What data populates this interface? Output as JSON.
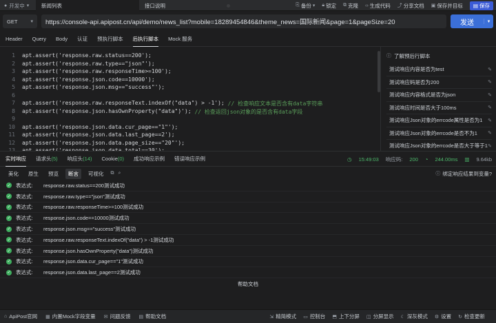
{
  "titlebar": {
    "env": "开发中",
    "tabs": [
      {
        "label": "新闻列表"
      },
      {
        "label": "接口说明"
      }
    ],
    "actions": [
      "备份",
      "锁定",
      "克隆",
      "生成代码",
      "分享文档",
      "保存并目标"
    ],
    "save_label": "保存"
  },
  "request": {
    "method": "GET",
    "url": "https://console-api.apipost.cn/api/demo/news_list?mobile=18289454846&theme_news=国际新闻&page=1&pageSize=20",
    "send_label": "发送"
  },
  "request_tabs": [
    "Header",
    "Query",
    "Body",
    "认证",
    "预执行脚本",
    "后执行脚本",
    "Mock 服务"
  ],
  "editor": {
    "lines": [
      {
        "n": "1",
        "code": "apt.assert('response.raw.status==200');",
        "comment": ""
      },
      {
        "n": "2",
        "code": "apt.assert('response.raw.type==\"json\"');",
        "comment": ""
      },
      {
        "n": "3",
        "code": "apt.assert('response.raw.responseTime>=100');",
        "comment": ""
      },
      {
        "n": "4",
        "code": "apt.assert('response.json.code==10000');",
        "comment": ""
      },
      {
        "n": "5",
        "code": "apt.assert('response.json.msg==\"success\"');",
        "comment": ""
      },
      {
        "n": "6",
        "code": "",
        "comment": ""
      },
      {
        "n": "7",
        "code": "apt.assert('response.raw.responseText.indexOf(\"data\") > -1');",
        "comment": " // 检查响应文本是否含有data字符串"
      },
      {
        "n": "8",
        "code": "apt.assert('response.json.hasOwnProperty(\"data\")');",
        "comment": " // 检查返回json对象的是否含有data字段"
      },
      {
        "n": "9",
        "code": "",
        "comment": ""
      },
      {
        "n": "10",
        "code": "apt.assert('response.json.data.cur_page==\"1\"');",
        "comment": ""
      },
      {
        "n": "11",
        "code": "apt.assert('response.json.data.last_page==2');",
        "comment": ""
      },
      {
        "n": "12",
        "code": "apt.assert('response.json.data.page_size==\"20\"');",
        "comment": ""
      },
      {
        "n": "13",
        "code": "apt.assert('response.json.data.total==30');",
        "comment": ""
      }
    ]
  },
  "snippets": {
    "header": "了解预后行脚本",
    "items": [
      "测试响应内容是否为test",
      "测试响应码是否为200",
      "测试响应内容格式是否为json",
      "测试响应时间是否大于100ms",
      "测试响应Json对象的errcode属性是否为1",
      "测试响应Json对象的errcode是否不为1",
      "测试响应Json对象的errcode是否大于等于1"
    ]
  },
  "response_tabs": [
    {
      "label": "实时响应",
      "badge": ""
    },
    {
      "label": "请求头",
      "badge": "(5)"
    },
    {
      "label": "响应头",
      "badge": "(14)"
    },
    {
      "label": "Cookie",
      "badge": "(0)"
    },
    {
      "label": "成功响应示例",
      "badge": ""
    },
    {
      "label": "错误响应示例",
      "badge": ""
    }
  ],
  "response_meta": {
    "time": "15:49:03",
    "status_label": "响应码:",
    "status": "200",
    "duration": "244.00ms",
    "size": "9.64kb"
  },
  "response_sub": {
    "buttons": [
      "美化",
      "原生",
      "预览",
      "断言",
      "可视化"
    ],
    "right": "绑定响应结果到变量?"
  },
  "results": {
    "label": "表达式:",
    "items": [
      "response.raw.status==200测试成功",
      "response.raw.type==\"json\"测试成功",
      "response.raw.responseTime>=100测试成功",
      "response.json.code==10000测试成功",
      "response.json.msg==\"success\"测试成功",
      "response.raw.responseText.indexOf(\"data\") > -1测试成功",
      "response.json.hasOwnProperty(\"data\")测试成功",
      "response.json.data.cur_page==\"1\"测试成功",
      "response.json.data.last_page==2测试成功"
    ]
  },
  "help_label": "帮助文档",
  "statusbar": {
    "left": [
      "ApiPost官网",
      "内置Mock字段变量",
      "问题反馈",
      "帮助文档"
    ],
    "right": [
      "精简模式",
      "控制台",
      "上下分屏",
      "分屏显示",
      "深灰模式",
      "设置",
      "检查更新"
    ]
  }
}
